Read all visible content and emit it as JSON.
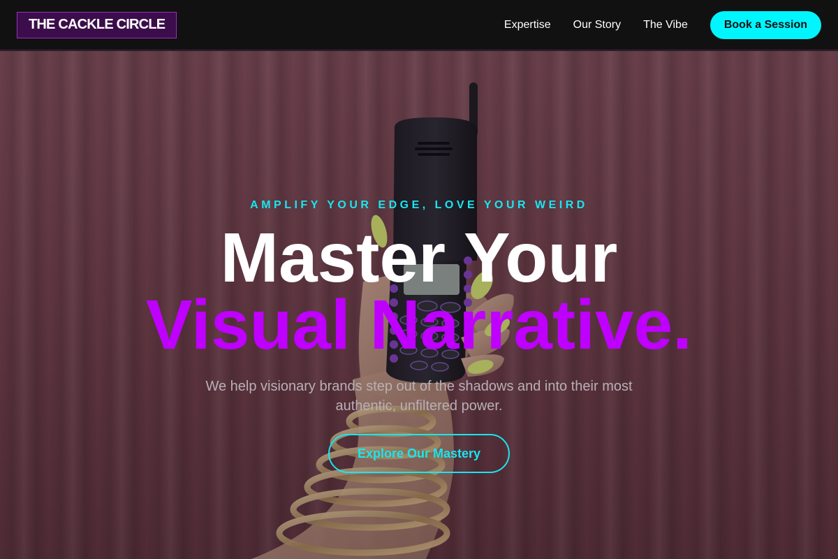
{
  "nav": {
    "logo": "THE CACKLE CIRCLE",
    "links": [
      "Expertise",
      "Our Story",
      "The Vibe"
    ],
    "cta_label": "Book a Session"
  },
  "hero": {
    "eyebrow": "AMPLIFY YOUR EDGE, LOVE YOUR WEIRD",
    "headline_line1": "Master Your",
    "headline_line2": "Visual Narrative.",
    "subtext": "We help visionary brands step out of the shadows and into their most authentic, unfiltered power.",
    "button_label": "Explore Our Mastery",
    "image_description_icon": "hand-holding-phone-image"
  },
  "colors": {
    "nav_bg": "#111111",
    "logo_bg": "#3b0d4a",
    "logo_border": "#9b2fc7",
    "accent_cyan": "#00f5ff",
    "accent_purple": "#bf00ff"
  }
}
